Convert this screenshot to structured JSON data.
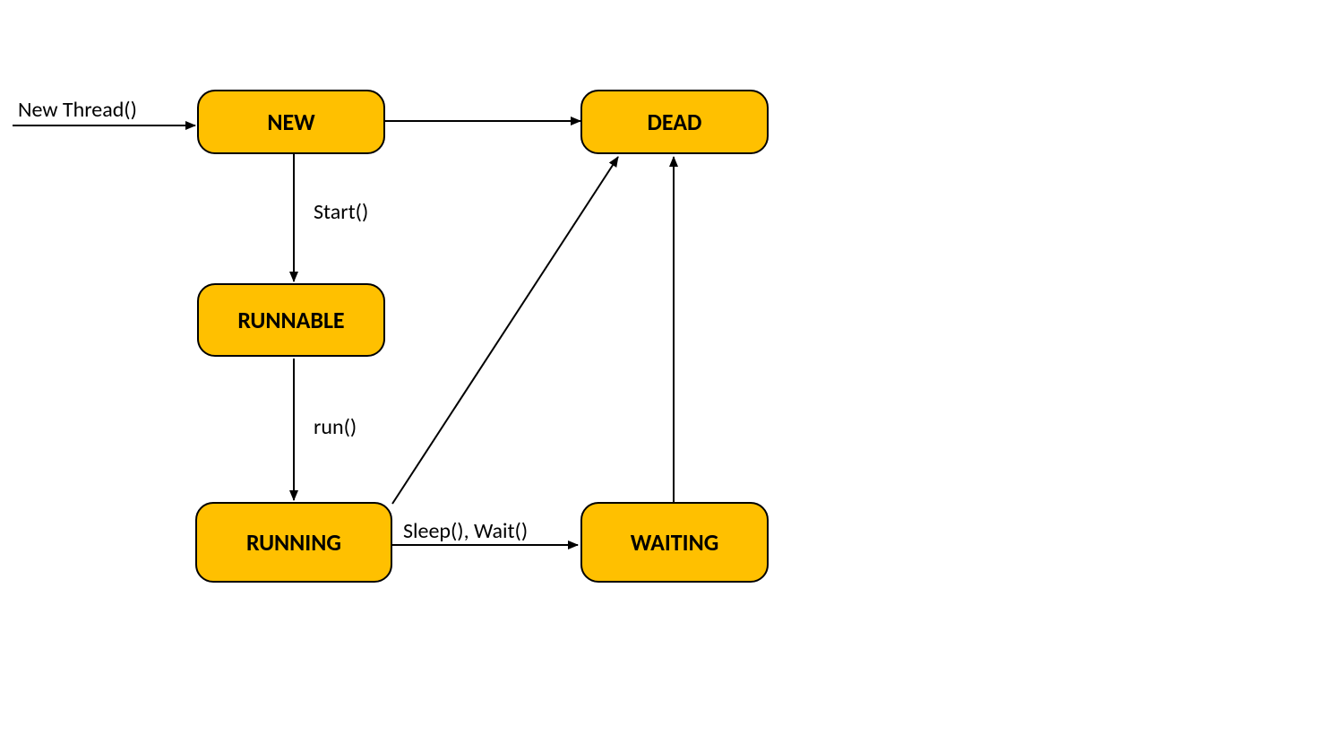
{
  "states": {
    "new": "NEW",
    "dead": "DEAD",
    "runnable": "RUNNABLE",
    "running": "RUNNING",
    "waiting": "WAITING"
  },
  "transitions": {
    "entry": "New Thread()",
    "new_to_runnable": "Start()",
    "runnable_to_running": "run()",
    "running_to_waiting": "Sleep(), Wait()"
  },
  "colors": {
    "state_fill": "#ffc000",
    "line": "#000000"
  }
}
